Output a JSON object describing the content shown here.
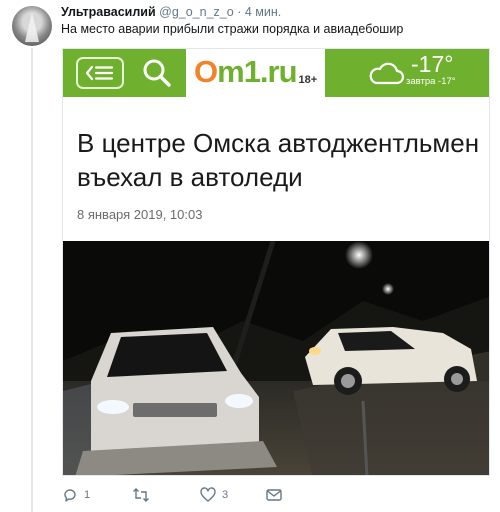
{
  "tweet": {
    "author_name": "Ультравасилий",
    "handle": "@g_o_n_z_o",
    "separator": "·",
    "time": "4 мин.",
    "text": "На место аварии прибыли стражи порядка и авиадебошир"
  },
  "card": {
    "logo_main": "Om1.ru",
    "logo_age": "18+",
    "weather_temp": "-17°",
    "weather_tomorrow": "завтра -17°",
    "headline": "В центре Омска автоджентльмен въехал в автоледи",
    "date": "8 января 2019, 10:03"
  },
  "actions": {
    "reply_count": "1",
    "retweet_count": "",
    "like_count": "3"
  },
  "icons": [
    "menu-back-icon",
    "search-icon",
    "cloud-icon",
    "reply-icon",
    "retweet-icon",
    "like-icon",
    "message-icon"
  ],
  "colors": {
    "site_green": "#6fb12e",
    "logo_orange": "#f0842a",
    "muted_text": "#657786"
  }
}
